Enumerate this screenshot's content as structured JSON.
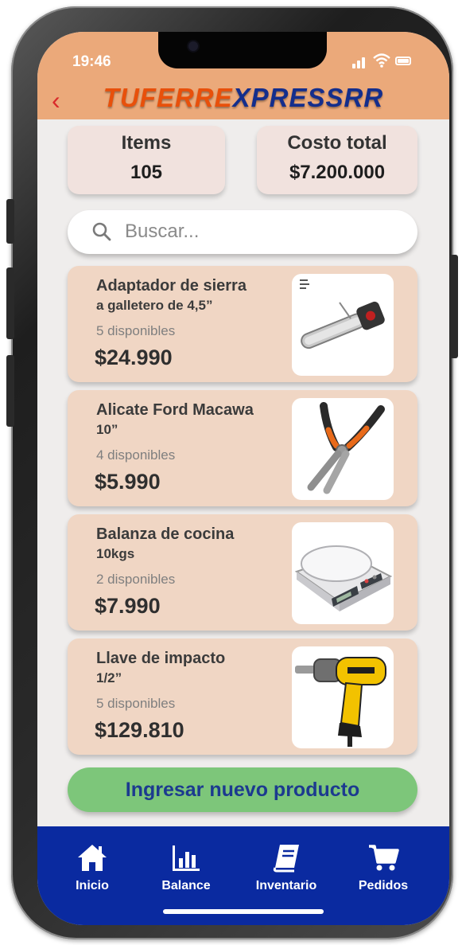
{
  "status_bar": {
    "time": "19:46"
  },
  "header": {
    "brand_part1": "TUFERRE",
    "brand_part2": "XPRESSRR",
    "back_icon": "chevron-left-icon"
  },
  "summary": {
    "items_label": "Items",
    "items_value": "105",
    "cost_label": "Costo total",
    "cost_value": "$7.200.000"
  },
  "search": {
    "placeholder": "Buscar..."
  },
  "products": [
    {
      "name_line1": "Adaptador de sierra",
      "name_line2": "a galletero de 4,5”",
      "stock": "5 disponibles",
      "price": "$24.990",
      "image_icon": "chainsaw-adapter-image"
    },
    {
      "name_line1": "Alicate Ford Macawa",
      "name_line2": "10”",
      "stock": "4 disponibles",
      "price": "$5.990",
      "image_icon": "pliers-image"
    },
    {
      "name_line1": "Balanza de cocina",
      "name_line2": "10kgs",
      "stock": "2 disponibles",
      "price": "$7.990",
      "image_icon": "kitchen-scale-image"
    },
    {
      "name_line1": "Llave de impacto",
      "name_line2": "1/2”",
      "stock": "5 disponibles",
      "price": "$129.810",
      "image_icon": "impact-wrench-image"
    }
  ],
  "actions": {
    "add_product": "Ingresar nuevo producto"
  },
  "tabs": [
    {
      "label": "Inicio",
      "icon": "home-icon"
    },
    {
      "label": "Balance",
      "icon": "bar-chart-icon"
    },
    {
      "label": "Inventario",
      "icon": "book-icon"
    },
    {
      "label": "Pedidos",
      "icon": "cart-icon"
    }
  ],
  "colors": {
    "header": "#eba97a",
    "brand_orange": "#e8500b",
    "brand_blue": "#142e8c",
    "card": "#f0d6c4",
    "add_button": "#7dc67a",
    "tabbar": "#0a2aa0"
  }
}
